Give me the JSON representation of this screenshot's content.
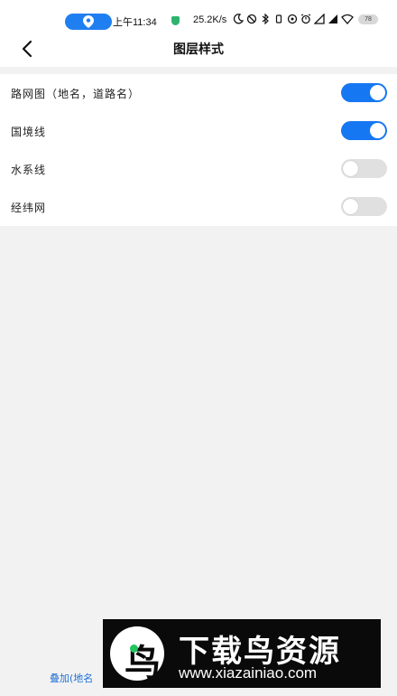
{
  "status_bar": {
    "time": "上午11:34",
    "net_speed": "25.2K/s",
    "battery": "78"
  },
  "header": {
    "title": "图层样式"
  },
  "settings": [
    {
      "label": "路网图（地名，道路名）",
      "enabled": true
    },
    {
      "label": "国境线",
      "enabled": true
    },
    {
      "label": "水系线",
      "enabled": false
    },
    {
      "label": "经纬网",
      "enabled": false
    }
  ],
  "footer": {
    "partial_text": "叠加(地名"
  },
  "watermark": {
    "name": "下载鸟资源",
    "url": "www.xiazainiao.com",
    "logo_char": "鸟"
  },
  "colors": {
    "accent": "#1677f2",
    "toggle_off": "#e0e0e0",
    "background": "#f2f2f2"
  }
}
